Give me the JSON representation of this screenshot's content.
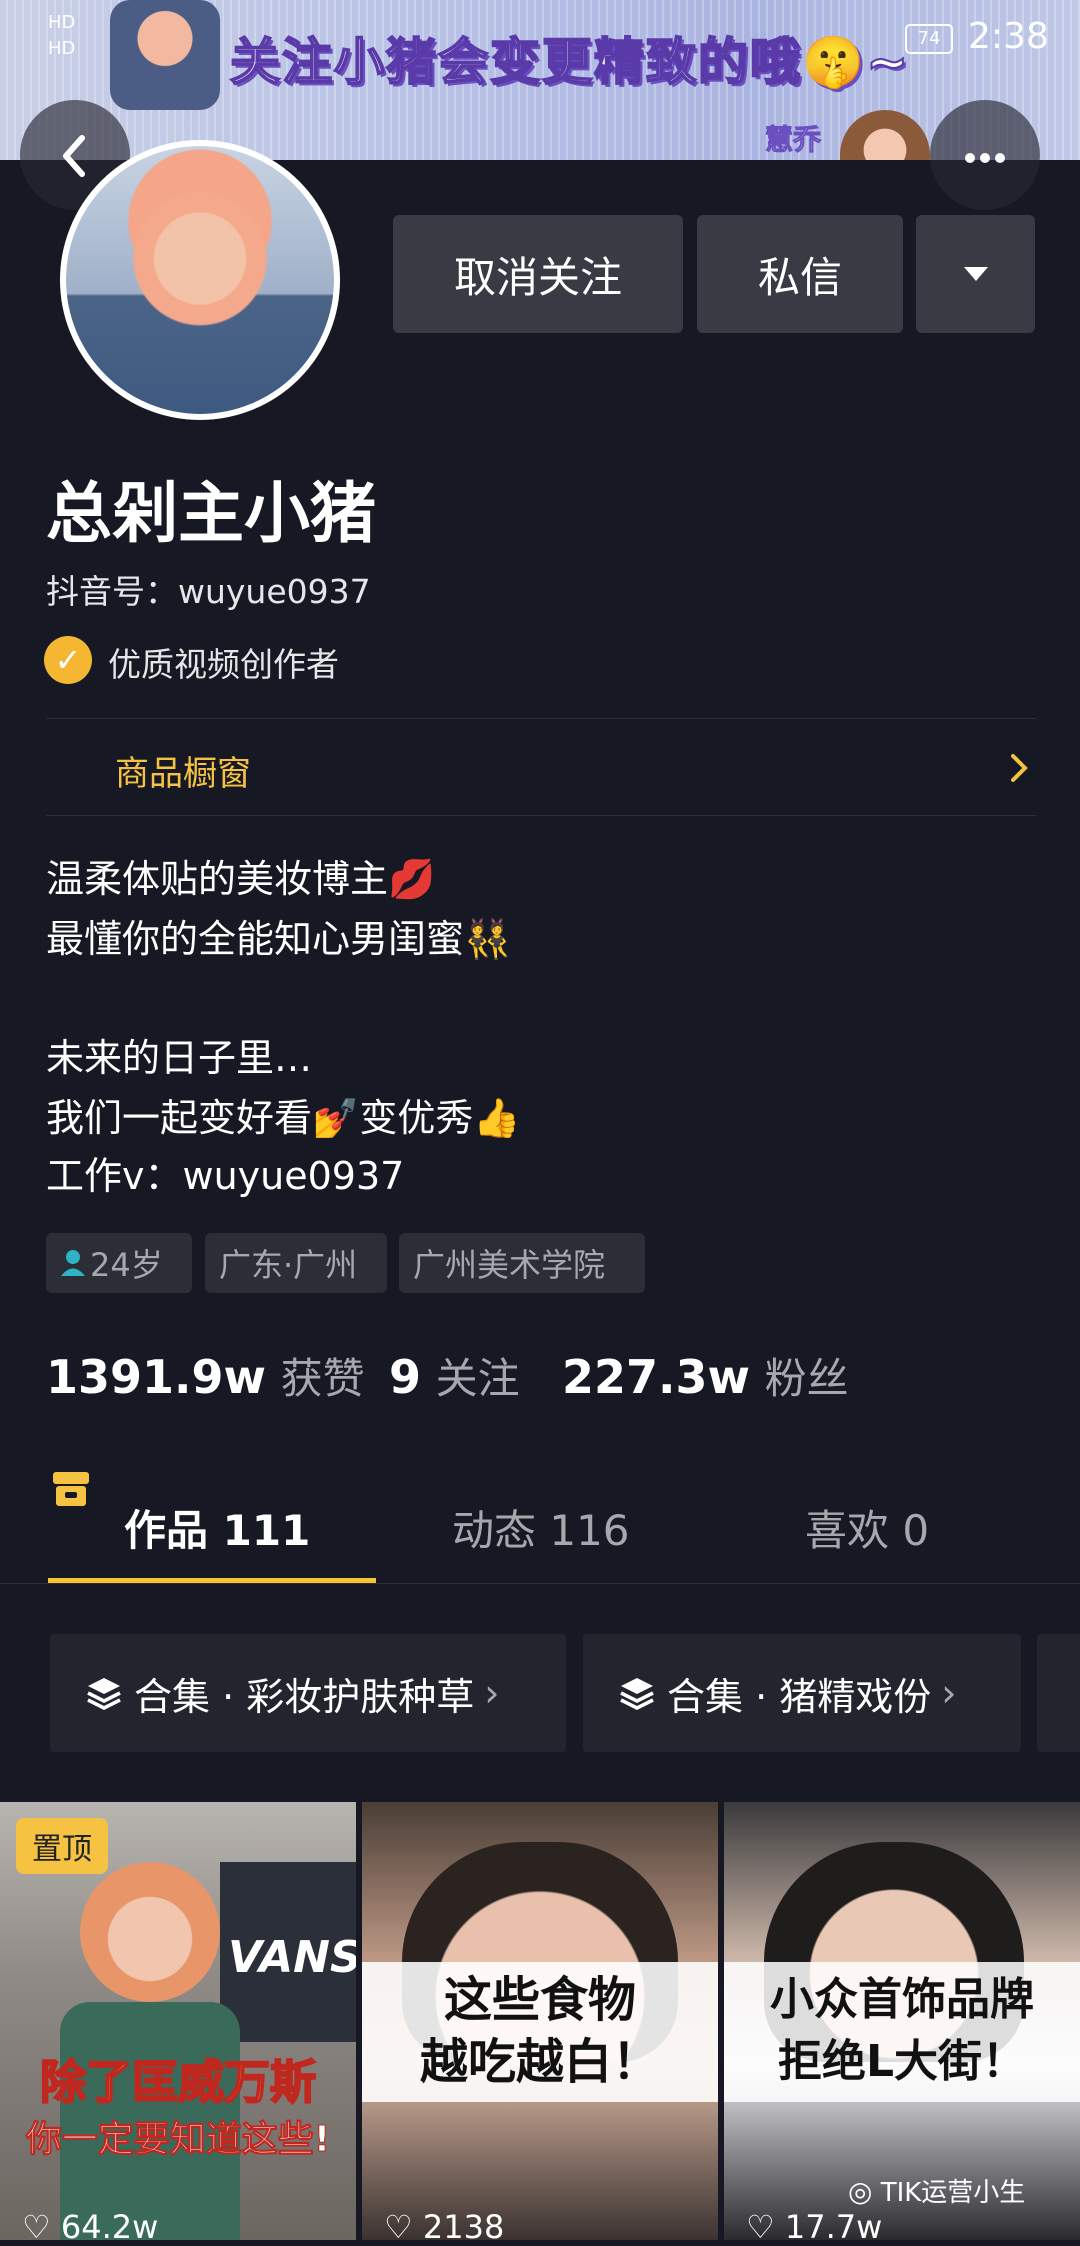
{
  "status_bar": {
    "left_top": "HD",
    "left_bottom": "HD",
    "battery": "74",
    "time": "2:38"
  },
  "banner": {
    "text": "关注小猪会变更精致的哦🤫~",
    "name": "慧乔"
  },
  "header": {
    "back_icon": "back-arrow-icon",
    "more_icon": "more-dots-icon"
  },
  "actions": {
    "unfollow": "取消关注",
    "message": "私信",
    "dropdown_icon": "caret-down-icon"
  },
  "profile": {
    "name": "总剁主小猪",
    "douyin_id": "抖音号：wuyue0937",
    "badge": "优质视频创作者"
  },
  "shop": {
    "label": "商品橱窗"
  },
  "bio": {
    "line1": "温柔体贴的美妆博主💋",
    "line2": "最懂你的全能知心男闺蜜👯",
    "line3": "未来的日子里…",
    "line4": "我们一起变好看💅变优秀👍",
    "line5": "工作v：wuyue0937"
  },
  "tags": {
    "age": "24岁",
    "location": "广东·广州",
    "school": "广州美术学院"
  },
  "stats": {
    "likes_num": "1391.9w",
    "likes_label": "获赞",
    "following_num": "9",
    "following_label": "关注",
    "followers_num": "227.3w",
    "followers_label": "粉丝"
  },
  "tabs": {
    "works": "作品 111",
    "activity": "动态 116",
    "likes": "喜欢 0"
  },
  "collections": {
    "c1": "合集 · 彩妆护肤种草",
    "c2": "合集 · 猪精戏份"
  },
  "videos": {
    "v1_pin": "置顶",
    "v1_brand": "VANS",
    "v1_cap1": "除了匡威万斯",
    "v1_cap2": "你一定要知道这些!",
    "v1_likes": "64.2w",
    "v2_cap1": "这些食物",
    "v2_cap2": "越吃越白！",
    "v2_likes": "2138",
    "v3_cap1": "小众首饰品牌",
    "v3_cap2": "拒绝L大街！",
    "v3_likes": "17.7w"
  },
  "watermark": "TIK运营小生",
  "colors": {
    "background": "#161823",
    "accent": "#f7c531",
    "button": "#393b44"
  }
}
